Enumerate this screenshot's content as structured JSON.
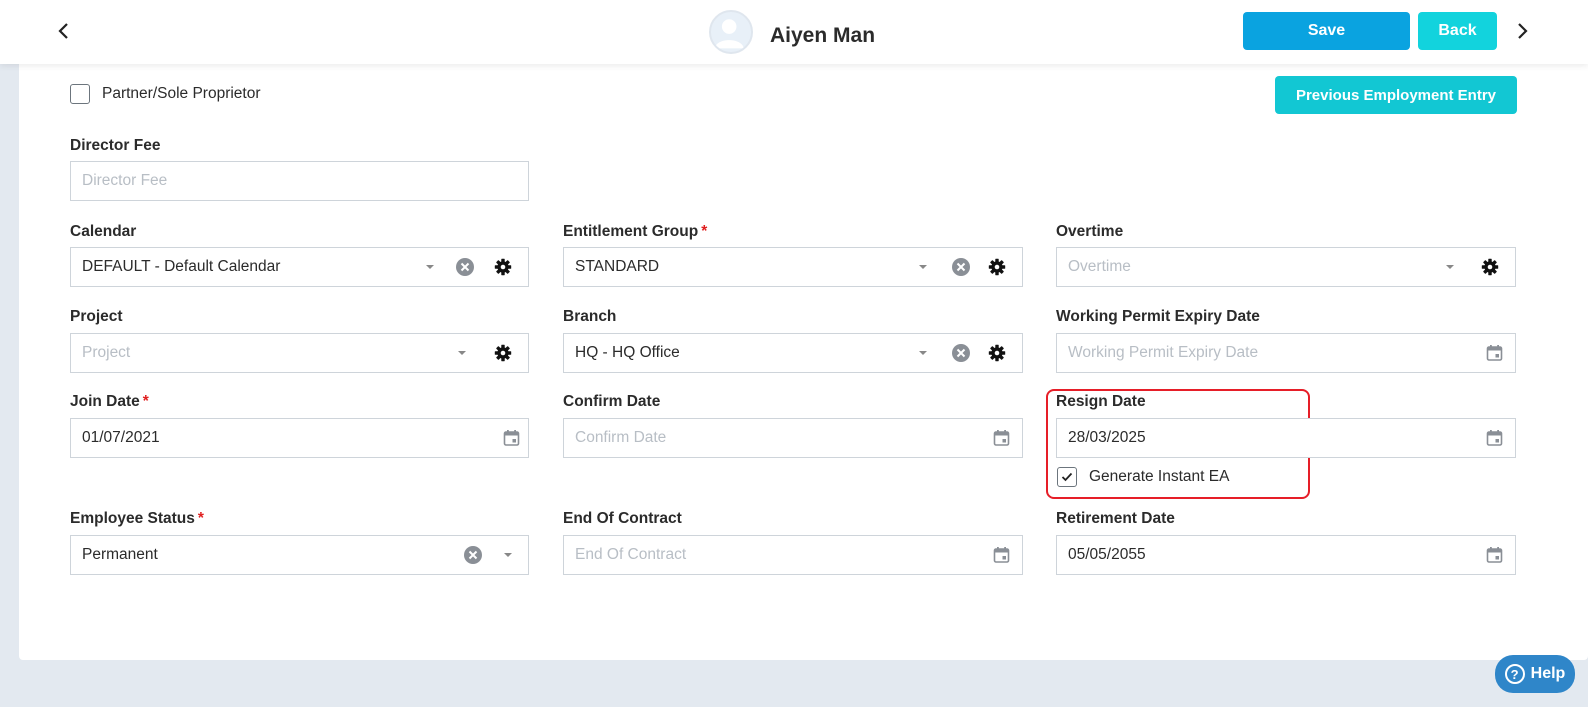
{
  "header": {
    "employee_name": "Aiyen Man",
    "save_label": "Save",
    "back_label": "Back",
    "colors": {
      "save": "#0aa3e0",
      "back": "#12d3dd"
    }
  },
  "form": {
    "partner_checkbox": {
      "label": "Partner/Sole Proprietor",
      "checked": false
    },
    "previous_employment_label": "Previous Employment Entry",
    "director_fee": {
      "label": "Director Fee",
      "value": "",
      "placeholder": "Director Fee"
    },
    "calendar": {
      "label": "Calendar",
      "value": "DEFAULT - Default Calendar"
    },
    "entitlement_group": {
      "label": "Entitlement Group",
      "value": "STANDARD",
      "required": "*"
    },
    "overtime": {
      "label": "Overtime",
      "value": "",
      "placeholder": "Overtime"
    },
    "project": {
      "label": "Project",
      "value": "",
      "placeholder": "Project"
    },
    "branch": {
      "label": "Branch",
      "value": "HQ - HQ Office"
    },
    "working_permit_expiry": {
      "label": "Working Permit Expiry Date",
      "value": "",
      "placeholder": "Working Permit Expiry Date"
    },
    "join_date": {
      "label": "Join Date",
      "value": "01/07/2021",
      "required": "*"
    },
    "confirm_date": {
      "label": "Confirm Date",
      "value": "",
      "placeholder": "Confirm Date"
    },
    "resign_date": {
      "label": "Resign Date",
      "value": "28/03/2025"
    },
    "generate_instant_ea": {
      "label": "Generate Instant EA",
      "checked": true
    },
    "employee_status": {
      "label": "Employee Status",
      "value": "Permanent",
      "required": "*"
    },
    "end_of_contract": {
      "label": "End Of Contract",
      "value": "",
      "placeholder": "End Of Contract"
    },
    "retirement_date": {
      "label": "Retirement Date",
      "value": "05/05/2055"
    }
  },
  "help": {
    "label": "Help"
  },
  "accent": {
    "highlight_border": "#e61e28",
    "required": "#e02020"
  },
  "icons": [
    "chevron-left-icon",
    "chevron-right-icon",
    "dropdown-caret-icon",
    "clear-icon",
    "gear-icon",
    "calendar-icon",
    "check-icon",
    "question-icon"
  ]
}
